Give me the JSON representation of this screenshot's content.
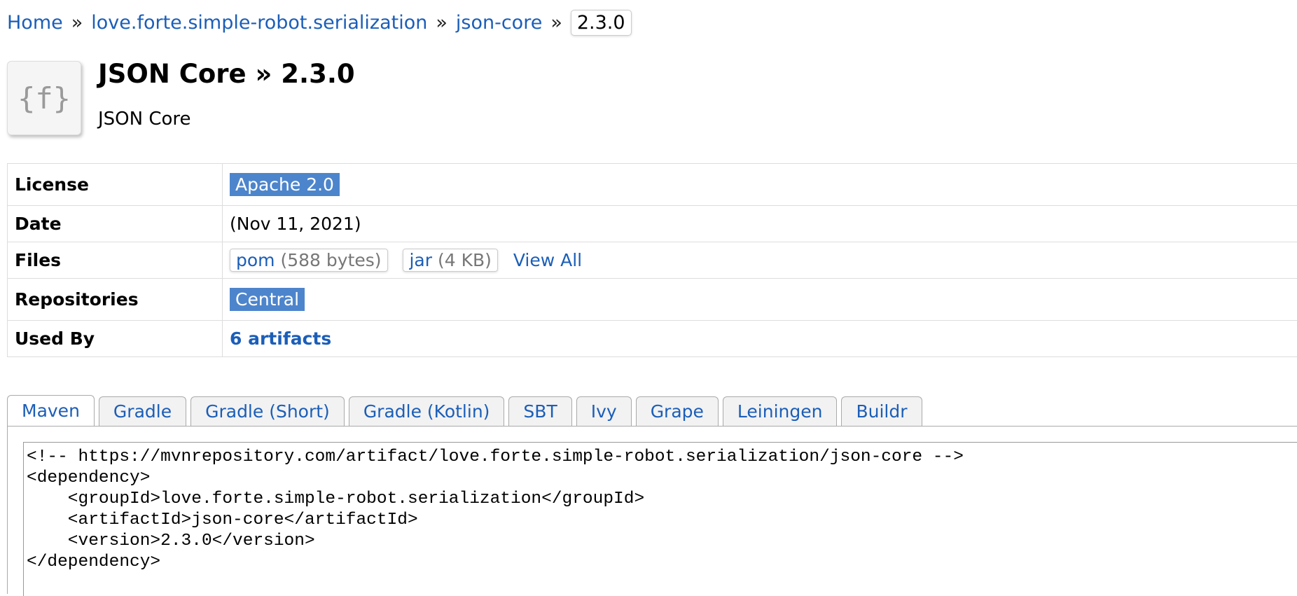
{
  "breadcrumb": {
    "home": "Home",
    "sep": "»",
    "group": "love.forte.simple-robot.serialization",
    "artifact": "json-core",
    "version": "2.3.0"
  },
  "header": {
    "logo_text": "{f}",
    "title": "JSON Core » 2.3.0",
    "subtitle": "JSON Core"
  },
  "info": {
    "license_label": "License",
    "license_value": "Apache 2.0",
    "date_label": "Date",
    "date_value": "(Nov 11, 2021)",
    "files_label": "Files",
    "files": [
      {
        "name": "pom",
        "size": "(588 bytes)"
      },
      {
        "name": "jar",
        "size": "(4 KB)"
      }
    ],
    "view_all": "View All",
    "repositories_label": "Repositories",
    "repositories_value": "Central",
    "used_by_label": "Used By",
    "used_by_value": "6 artifacts"
  },
  "tabs": [
    {
      "label": "Maven",
      "active": true
    },
    {
      "label": "Gradle"
    },
    {
      "label": "Gradle (Short)"
    },
    {
      "label": "Gradle (Kotlin)"
    },
    {
      "label": "SBT"
    },
    {
      "label": "Ivy"
    },
    {
      "label": "Grape"
    },
    {
      "label": "Leiningen"
    },
    {
      "label": "Buildr"
    }
  ],
  "code": {
    "lines": [
      "<!-- https://mvnrepository.com/artifact/love.forte.simple-robot.serialization/json-core -->",
      "<dependency>",
      "    <groupId>love.forte.simple-robot.serialization</groupId>",
      "    <artifactId>json-core</artifactId>",
      "    <version>2.3.0</version>",
      "</dependency>"
    ]
  },
  "colors": {
    "link": "#1b5eb8",
    "tag_bg": "#4d85cc",
    "border": "#dddddd"
  }
}
